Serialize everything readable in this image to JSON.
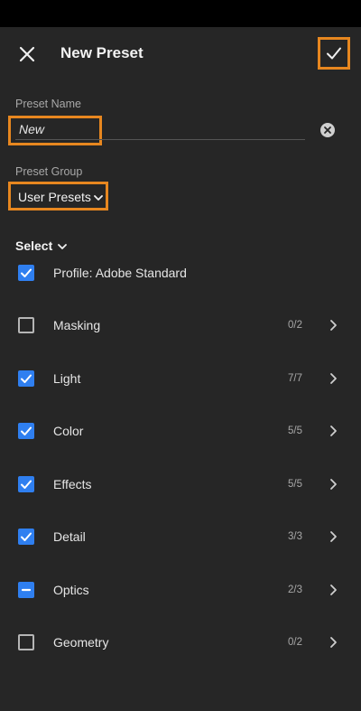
{
  "header": {
    "title": "New Preset",
    "close_icon": "close-icon",
    "confirm_icon": "checkmark-icon"
  },
  "preset_name": {
    "label": "Preset Name",
    "value": "New",
    "clear_icon": "clear-icon"
  },
  "preset_group": {
    "label": "Preset Group",
    "value": "User Presets"
  },
  "select": {
    "label": "Select"
  },
  "items": [
    {
      "label": "Profile: Adobe Standard",
      "state": "checked",
      "count": ""
    },
    {
      "label": "Masking",
      "state": "unchecked",
      "count": "0/2"
    },
    {
      "label": "Light",
      "state": "checked",
      "count": "7/7"
    },
    {
      "label": "Color",
      "state": "checked",
      "count": "5/5"
    },
    {
      "label": "Effects",
      "state": "checked",
      "count": "5/5"
    },
    {
      "label": "Detail",
      "state": "checked",
      "count": "3/3"
    },
    {
      "label": "Optics",
      "state": "mixed",
      "count": "2/3"
    },
    {
      "label": "Geometry",
      "state": "unchecked",
      "count": "0/2"
    }
  ],
  "colors": {
    "accent": "#2f7ff0",
    "highlight": "#e7871f",
    "panel": "#262626"
  }
}
